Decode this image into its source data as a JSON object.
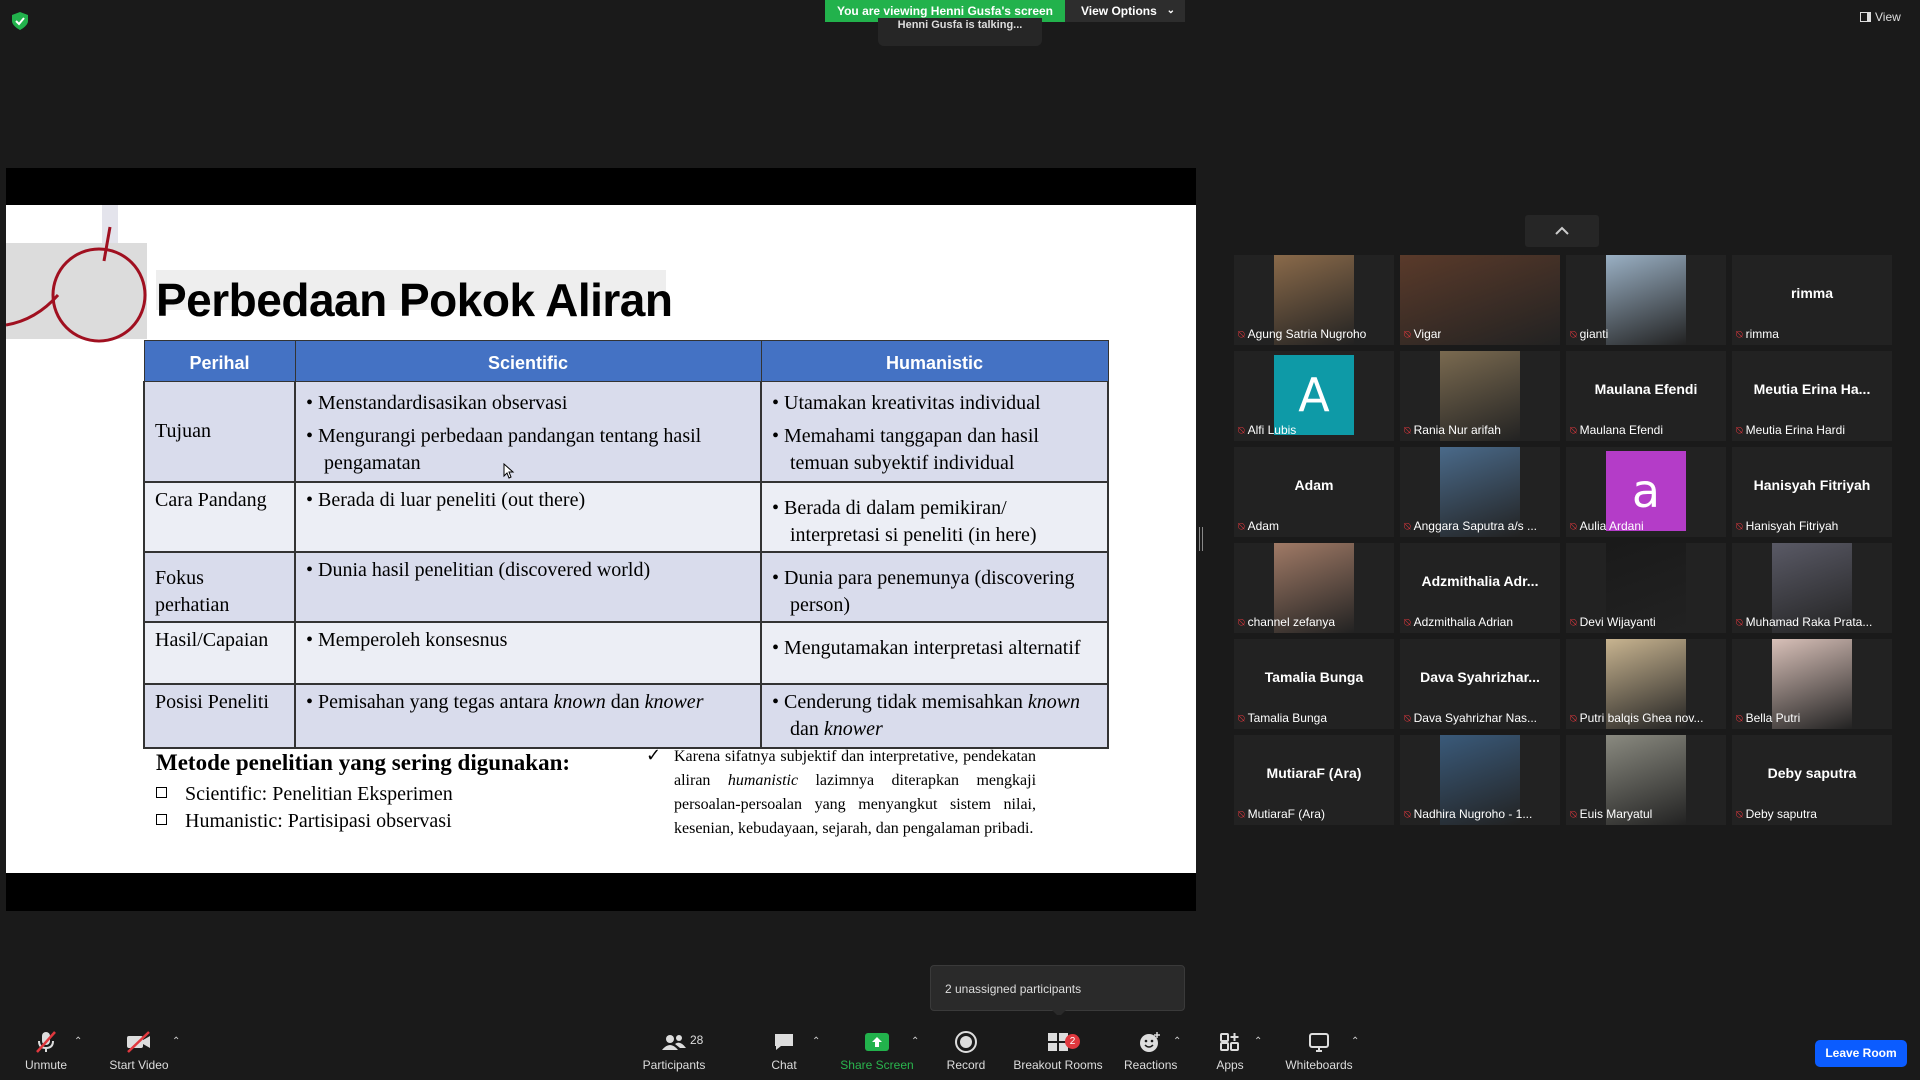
{
  "top": {
    "banner": "You are viewing Henni Gusfa's screen",
    "view_options": "View Options",
    "talking": "Henni Gusfa is talking...",
    "view": "View"
  },
  "slide": {
    "title": "Perbedaan Pokok Aliran",
    "headers": [
      "Perihal",
      "Scientific",
      "Humanistic"
    ],
    "rows": [
      {
        "perihal": "Tujuan",
        "scientific": [
          "Menstandardisasikan observasi",
          "Mengurangi perbedaan pandangan tentang hasil pengamatan"
        ],
        "humanistic": [
          "Utamakan kreativitas individual",
          "Memahami tanggapan dan hasil temuan subyektif individual"
        ]
      },
      {
        "perihal": "Cara Pandang",
        "scientific": [
          "Berada di luar peneliti (out there)"
        ],
        "humanistic": [
          "Berada di dalam pemikiran/ interpretasi si peneliti (in here)"
        ]
      },
      {
        "perihal": "Fokus perhatian",
        "scientific": [
          "Dunia hasil penelitian (discovered world)"
        ],
        "humanistic": [
          "Dunia para penemunya (discovering person)"
        ]
      },
      {
        "perihal": "Hasil/Capaian",
        "scientific": [
          "Memperoleh konsesnus"
        ],
        "humanistic": [
          "Mengutamakan interpretasi alternatif"
        ]
      },
      {
        "perihal": "Posisi Peneliti",
        "scientific_parts": [
          "Pemisahan yang tegas antara ",
          "known",
          " dan ",
          "knower"
        ],
        "humanistic_parts": [
          "Cenderung tidak memisahkan ",
          "known",
          " dan ",
          "knower"
        ]
      }
    ],
    "methods_title": "Metode penelitian yang sering digunakan:",
    "methods": [
      "Scientific: Penelitian Eksperimen",
      "Humanistic: Partisipasi observasi"
    ],
    "note_check": "✓",
    "note_parts": [
      "Karena sifatnya subjektif dan interpretative, pendekatan aliran ",
      "humanistic",
      " lazimnya diterapkan mengkaji persoalan-persoalan yang menyangkut sistem nilai, kesenian, kebudayaan, sejarah, dan pengalaman pribadi."
    ]
  },
  "participants": [
    {
      "label": "Agung Satria Nugroho",
      "kind": "photo",
      "color": "#8a6a4a"
    },
    {
      "label": "Vigar",
      "kind": "photo-wide",
      "color": "#5a3a2a"
    },
    {
      "label": "gianti",
      "kind": "photo",
      "color": "#9ab0c4"
    },
    {
      "label": "rimma",
      "kind": "name",
      "name": "rimma"
    },
    {
      "label": "Alfi Lubis",
      "kind": "letter",
      "letter": "A",
      "color": "#0e9aa7"
    },
    {
      "label": "Rania Nur arifah",
      "kind": "photo",
      "color": "#7a6a50"
    },
    {
      "label": "Maulana Efendi",
      "kind": "name",
      "name": "Maulana Efendi"
    },
    {
      "label": "Meutia Erina Hardi",
      "kind": "name",
      "name": "Meutia Erina Ha..."
    },
    {
      "label": "Adam",
      "kind": "name",
      "name": "Adam"
    },
    {
      "label": "Anggara Saputra a/s ...",
      "kind": "photo",
      "color": "#4a6a8a"
    },
    {
      "label": "Aulia Ardani",
      "kind": "letter",
      "letter": "a",
      "color": "#b43cc8"
    },
    {
      "label": "Hanisyah Fitriyah",
      "kind": "name",
      "name": "Hanisyah Fitriyah"
    },
    {
      "label": "channel zefanya",
      "kind": "photo",
      "color": "#a07a66"
    },
    {
      "label": "Adzmithalia Adrian",
      "kind": "name",
      "name": "Adzmithalia Adr..."
    },
    {
      "label": "Devi Wijayanti",
      "kind": "photo",
      "color": "#1a1a1a"
    },
    {
      "label": "Muhamad Raka Prata...",
      "kind": "photo",
      "color": "#5a5a66"
    },
    {
      "label": "Tamalia Bunga",
      "kind": "name",
      "name": "Tamalia Bunga"
    },
    {
      "label": "Dava Syahrizhar Nas...",
      "kind": "name",
      "name": "Dava Syahrizhar..."
    },
    {
      "label": "Putri balqis Ghea nov...",
      "kind": "photo",
      "color": "#c8b490"
    },
    {
      "label": "Bella Putri",
      "kind": "photo",
      "color": "#d8c0b8"
    },
    {
      "label": "MutiaraF (Ara)",
      "kind": "name",
      "name": "MutiaraF (Ara)"
    },
    {
      "label": "Nadhira Nugroho - 1...",
      "kind": "photo",
      "color": "#3a5a7a"
    },
    {
      "label": "Euis Maryatul",
      "kind": "photo",
      "color": "#8a8a80"
    },
    {
      "label": "Deby saputra",
      "kind": "name",
      "name": "Deby saputra"
    }
  ],
  "popup": "2 unassigned participants",
  "toolbar": {
    "unmute": "Unmute",
    "start_video": "Start Video",
    "participants": "Participants",
    "participants_count": "28",
    "chat": "Chat",
    "share_screen": "Share Screen",
    "record": "Record",
    "breakout_rooms": "Breakout Rooms",
    "breakout_badge": "2",
    "reactions": "Reactions",
    "apps": "Apps",
    "whiteboards": "Whiteboards",
    "leave": "Leave Room"
  }
}
